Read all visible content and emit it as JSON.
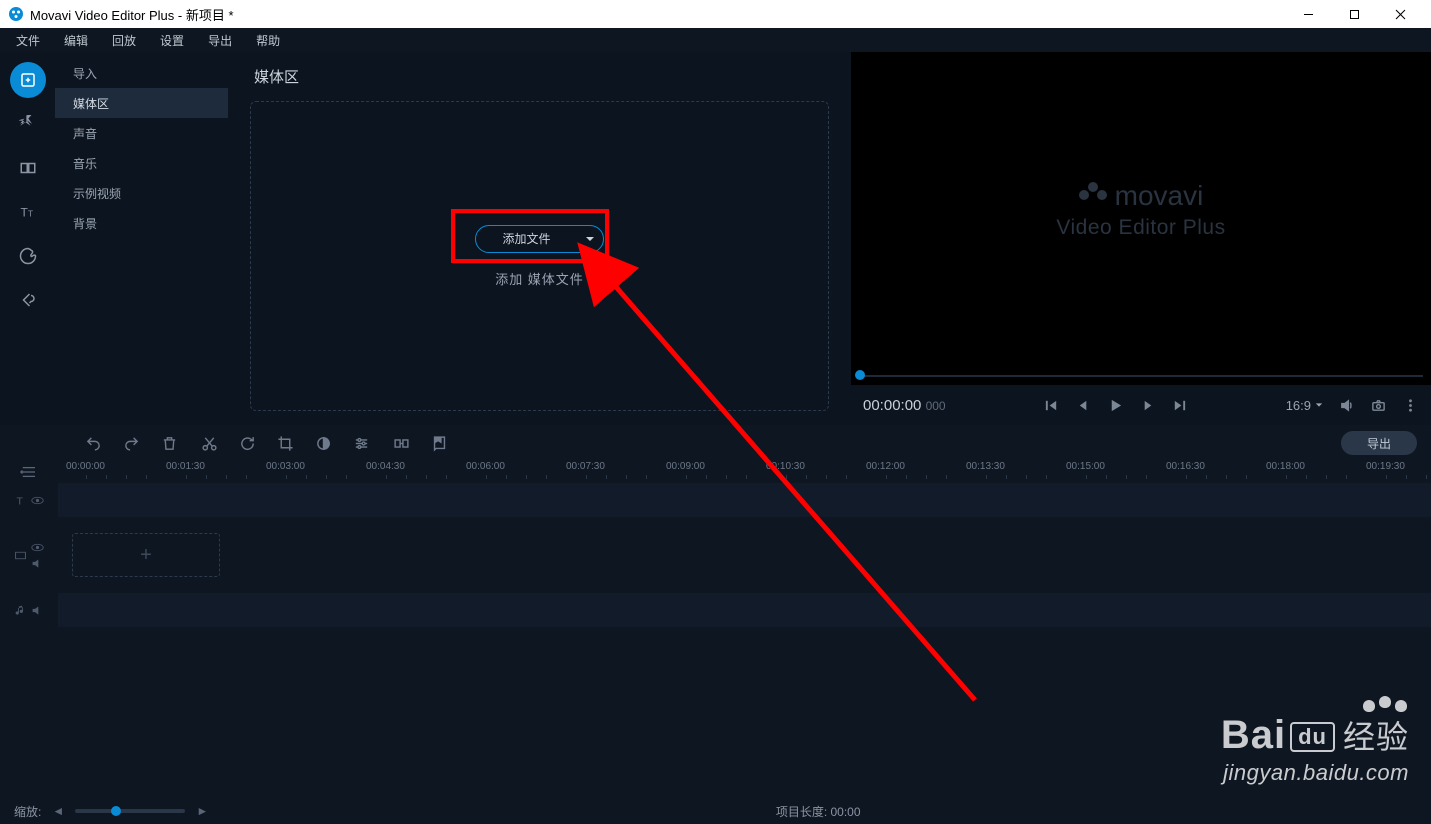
{
  "titlebar": {
    "title": "Movavi Video Editor Plus - 新项目 *"
  },
  "menubar": {
    "items": [
      "文件",
      "编辑",
      "回放",
      "设置",
      "导出",
      "帮助"
    ]
  },
  "tool_rail": {
    "tools": [
      {
        "name": "import-tool",
        "active": true
      },
      {
        "name": "effects-tool",
        "active": false
      },
      {
        "name": "transitions-tool",
        "active": false
      },
      {
        "name": "titles-tool",
        "active": false
      },
      {
        "name": "stickers-tool",
        "active": false
      },
      {
        "name": "more-tools",
        "active": false
      }
    ]
  },
  "import_list": {
    "items": [
      {
        "label": "导入",
        "active": false
      },
      {
        "label": "媒体区",
        "active": true
      },
      {
        "label": "声音",
        "active": false
      },
      {
        "label": "音乐",
        "active": false
      },
      {
        "label": "示例视频",
        "active": false
      },
      {
        "label": "背景",
        "active": false
      }
    ]
  },
  "media_panel": {
    "title": "媒体区",
    "add_button": "添加文件",
    "caption": "添加 媒体文件"
  },
  "preview": {
    "brand_top": "movavi",
    "brand_sub": "Video Editor Plus",
    "timecode": "00:00:00",
    "timecode_ms": "000",
    "ratio": "16:9"
  },
  "editbar": {
    "export": "导出"
  },
  "ruler": {
    "ticks": [
      "00:00:00",
      "00:01:30",
      "00:03:00",
      "00:04:30",
      "00:06:00",
      "00:07:30",
      "00:09:00",
      "00:10:30",
      "00:12:00",
      "00:13:30",
      "00:15:00",
      "00:16:30",
      "00:18:00",
      "00:19:30"
    ]
  },
  "footer": {
    "zoom_label": "缩放:",
    "duration_label": "项目长度:",
    "duration_value": "00:00"
  },
  "watermark": {
    "brand_a": "Bai",
    "brand_b": "du",
    "cn": "经验",
    "url": "jingyan.baidu.com"
  }
}
